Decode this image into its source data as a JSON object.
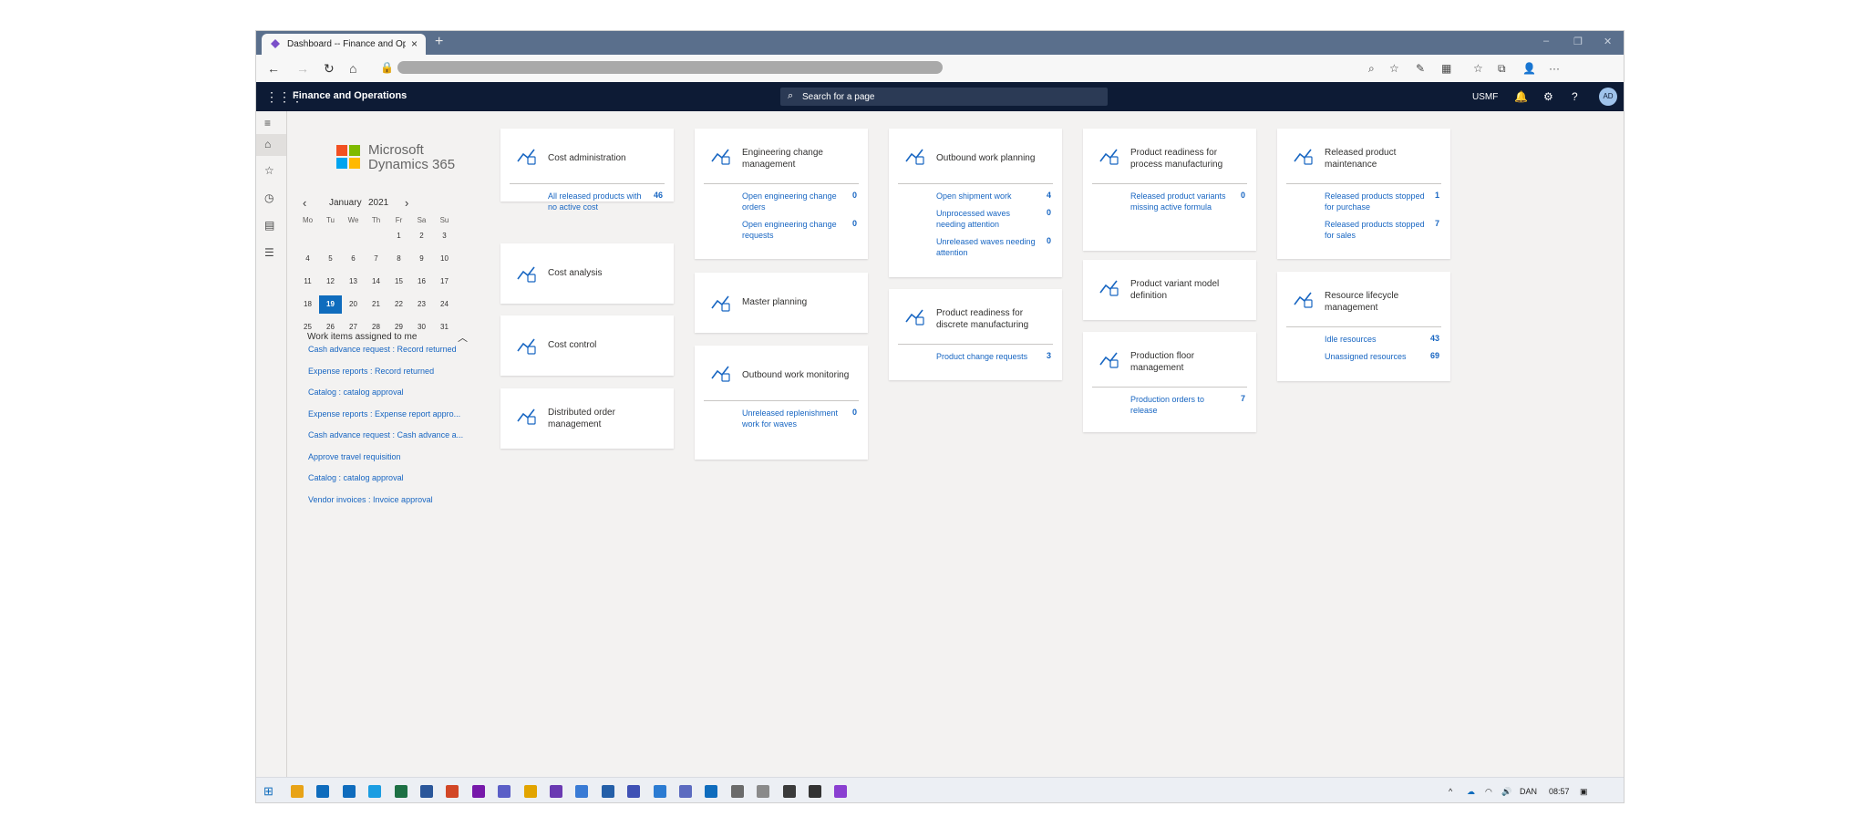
{
  "browser": {
    "tab_title": "Dashboard -- Finance and Operations",
    "tab_close": "×",
    "new_tab": "+",
    "window_controls": [
      "–",
      "❐",
      "✕"
    ],
    "nav_buttons": [
      "←",
      "→",
      "↻",
      "⌂"
    ],
    "right_icons": [
      "zoom-icon",
      "favorite-icon",
      "extension-icon",
      "collections-icon",
      "favorites-bar-icon",
      "edge-icon",
      "profile-icon",
      "more-icon"
    ],
    "right_glyphs": [
      "⌕",
      "☆",
      "✎",
      "▦",
      "☆",
      "⧉",
      "👤",
      "···"
    ]
  },
  "app": {
    "name": "Finance and Operations",
    "search_placeholder": "Search for a page",
    "company": "USMF",
    "avatar": "AD",
    "icons": [
      "notifications-icon",
      "settings-icon",
      "help-icon"
    ],
    "glyphs": [
      "🔔",
      "⚙",
      "?"
    ]
  },
  "leftnav": {
    "items": [
      {
        "icon": "hamburger-icon",
        "glyph": "≡"
      },
      {
        "icon": "home-icon",
        "glyph": "⌂"
      },
      {
        "icon": "favorites-icon",
        "glyph": "☆"
      },
      {
        "icon": "recent-icon",
        "glyph": "◷"
      },
      {
        "icon": "workspaces-icon",
        "glyph": "▤"
      },
      {
        "icon": "modules-icon",
        "glyph": "☰"
      }
    ]
  },
  "logo": {
    "line1": "Microsoft",
    "line2": "Dynamics 365"
  },
  "calendar": {
    "month": "January",
    "year": "2021",
    "prev": "‹",
    "next": "›",
    "weekdays": [
      "Mo",
      "Tu",
      "We",
      "Th",
      "Fr",
      "Sa",
      "Su"
    ],
    "weeks": [
      [
        "",
        "",
        "",
        "",
        "1",
        "2",
        "3"
      ],
      [
        "4",
        "5",
        "6",
        "7",
        "8",
        "9",
        "10"
      ],
      [
        "11",
        "12",
        "13",
        "14",
        "15",
        "16",
        "17"
      ],
      [
        "18",
        "19",
        "20",
        "21",
        "22",
        "23",
        "24"
      ],
      [
        "25",
        "26",
        "27",
        "28",
        "29",
        "30",
        "31"
      ]
    ],
    "today": "19"
  },
  "work_items": {
    "title": "Work items assigned to me",
    "chevron": "︿",
    "items": [
      "Cash advance request : Record returned",
      "Expense reports : Record returned",
      "Catalog : catalog approval",
      "Expense reports : Expense report appro...",
      "Cash advance request : Cash advance a...",
      "Approve travel requisition",
      "Catalog : catalog approval",
      "Vendor invoices : Invoice approval"
    ]
  },
  "tiles": [
    {
      "title": "Cost administration",
      "icon": "cost-admin-icon",
      "links": [
        {
          "label": "All released products with no active cost",
          "count": "46"
        }
      ]
    },
    {
      "title": "Cost analysis",
      "icon": "cost-analysis-icon",
      "links": []
    },
    {
      "title": "Cost control",
      "icon": "cost-control-icon",
      "links": []
    },
    {
      "title": "Distributed order management",
      "icon": "distributed-order-icon",
      "links": []
    },
    {
      "title": "Engineering change management",
      "icon": "engineering-change-icon",
      "links": [
        {
          "label": "Open engineering change orders",
          "count": "0"
        },
        {
          "label": "Open engineering change requests",
          "count": "0"
        }
      ]
    },
    {
      "title": "Master planning",
      "icon": "master-planning-icon",
      "links": []
    },
    {
      "title": "Outbound work monitoring",
      "icon": "outbound-monitoring-icon",
      "links": [
        {
          "label": "Unreleased replenishment work for waves",
          "count": "0"
        }
      ]
    },
    {
      "title": "Outbound work planning",
      "icon": "outbound-planning-icon",
      "links": [
        {
          "label": "Open shipment work",
          "count": "4"
        },
        {
          "label": "Unprocessed waves needing attention",
          "count": "0"
        },
        {
          "label": "Unreleased waves needing attention",
          "count": "0"
        }
      ]
    },
    {
      "title": "Product readiness for discrete manufacturing",
      "icon": "product-readiness-discrete-icon",
      "links": [
        {
          "label": "Product change requests",
          "count": "3"
        }
      ]
    },
    {
      "title": "Product readiness for process manufacturing",
      "icon": "product-readiness-process-icon",
      "links": [
        {
          "label": "Released product variants missing active formula",
          "count": "0"
        }
      ]
    },
    {
      "title": "Product variant model definition",
      "icon": "product-variant-icon",
      "links": []
    },
    {
      "title": "Production floor management",
      "icon": "production-floor-icon",
      "links": [
        {
          "label": "Production orders to release",
          "count": "7"
        }
      ]
    },
    {
      "title": "Released product maintenance",
      "icon": "released-product-icon",
      "links": [
        {
          "label": "Released products stopped for purchase",
          "count": "1"
        },
        {
          "label": "Released products stopped for sales",
          "count": "7"
        }
      ]
    },
    {
      "title": "Resource lifecycle management",
      "icon": "resource-lifecycle-icon",
      "links": [
        {
          "label": "Idle resources",
          "count": "43"
        },
        {
          "label": "Unassigned resources",
          "count": "69"
        }
      ]
    }
  ],
  "taskbar": {
    "start_icon": "windows-start-icon",
    "apps": [
      "explorer-icon",
      "outlook-icon",
      "mail-icon",
      "edge-icon",
      "excel-icon",
      "word-icon",
      "powerpoint-icon",
      "onenote-icon",
      "teams-icon",
      "paint-icon",
      "visual-studio-icon",
      "app-icon-1",
      "app-icon-2",
      "app-icon-3",
      "visual-studio-code-icon",
      "app-icon-4",
      "app-icon-5",
      "app-icon-6",
      "app-icon-7",
      "app-icon-8",
      "app-icon-9",
      "app-icon-10"
    ],
    "colors": [
      "#e8a317",
      "#0f6cbd",
      "#0f6cbd",
      "#1b9de2",
      "#1d7044",
      "#2b579a",
      "#d24726",
      "#7719aa",
      "#5b5fc7",
      "#e2a400",
      "#6a3ab2",
      "#3a7bd5",
      "#245fa8",
      "#3f51b5",
      "#2b7bd2",
      "#5c6bc0",
      "#0f6cbd",
      "#6b6b6b",
      "#8a8a8a",
      "#3b3b3b",
      "#333333",
      "#8a3fd1"
    ],
    "lang": "DAN",
    "time": "08:57",
    "tray_icons": [
      "chevron-up-icon",
      "onedrive-icon",
      "network-icon",
      "volume-icon",
      "notifications-icon"
    ],
    "tray_glyphs": [
      "^",
      "☁",
      "◠",
      "🔊",
      "▣"
    ]
  }
}
